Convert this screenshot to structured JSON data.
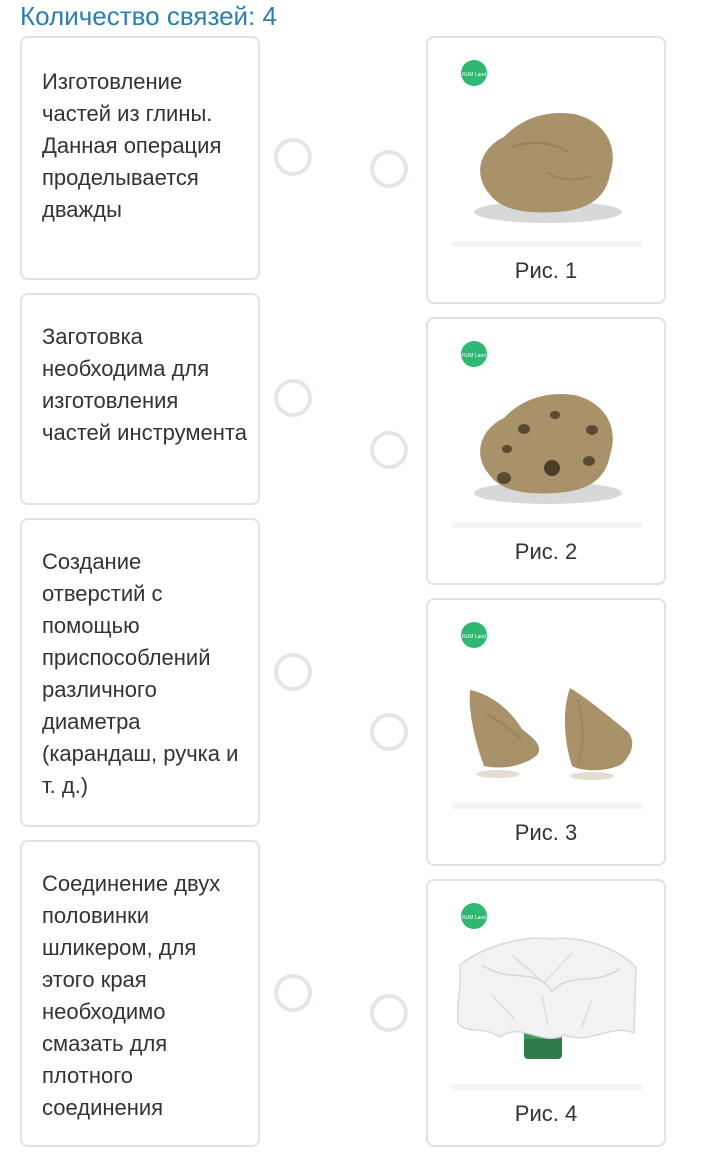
{
  "header": {
    "title": "Количество связей: 4"
  },
  "left_items": [
    {
      "text": "Изготовление частей из глины. Данная операция проделывается дважды"
    },
    {
      "text": "Заготовка необходима для изготовления частей инструмента"
    },
    {
      "text": "Создание отверстий с помощью приспособлений различного диаметра (карандаш, ручка и т. д.)"
    },
    {
      "text": "Соединение двух половинки шликером, для этого края необходимо смазать для плотного соединения"
    }
  ],
  "right_items": [
    {
      "caption": "Рис. 1",
      "image": "clay-lump"
    },
    {
      "caption": "Рис. 2",
      "image": "clay-lump-with-holes"
    },
    {
      "caption": "Рис. 3",
      "image": "two-clay-halves"
    },
    {
      "caption": "Рис. 4",
      "image": "paper-covered-bottle"
    }
  ],
  "logo_text": "RUM Land",
  "colors": {
    "title": "#2a7fae",
    "logo": "#2eb872",
    "clay": "#a9916a",
    "border": "#dfe3e6"
  }
}
